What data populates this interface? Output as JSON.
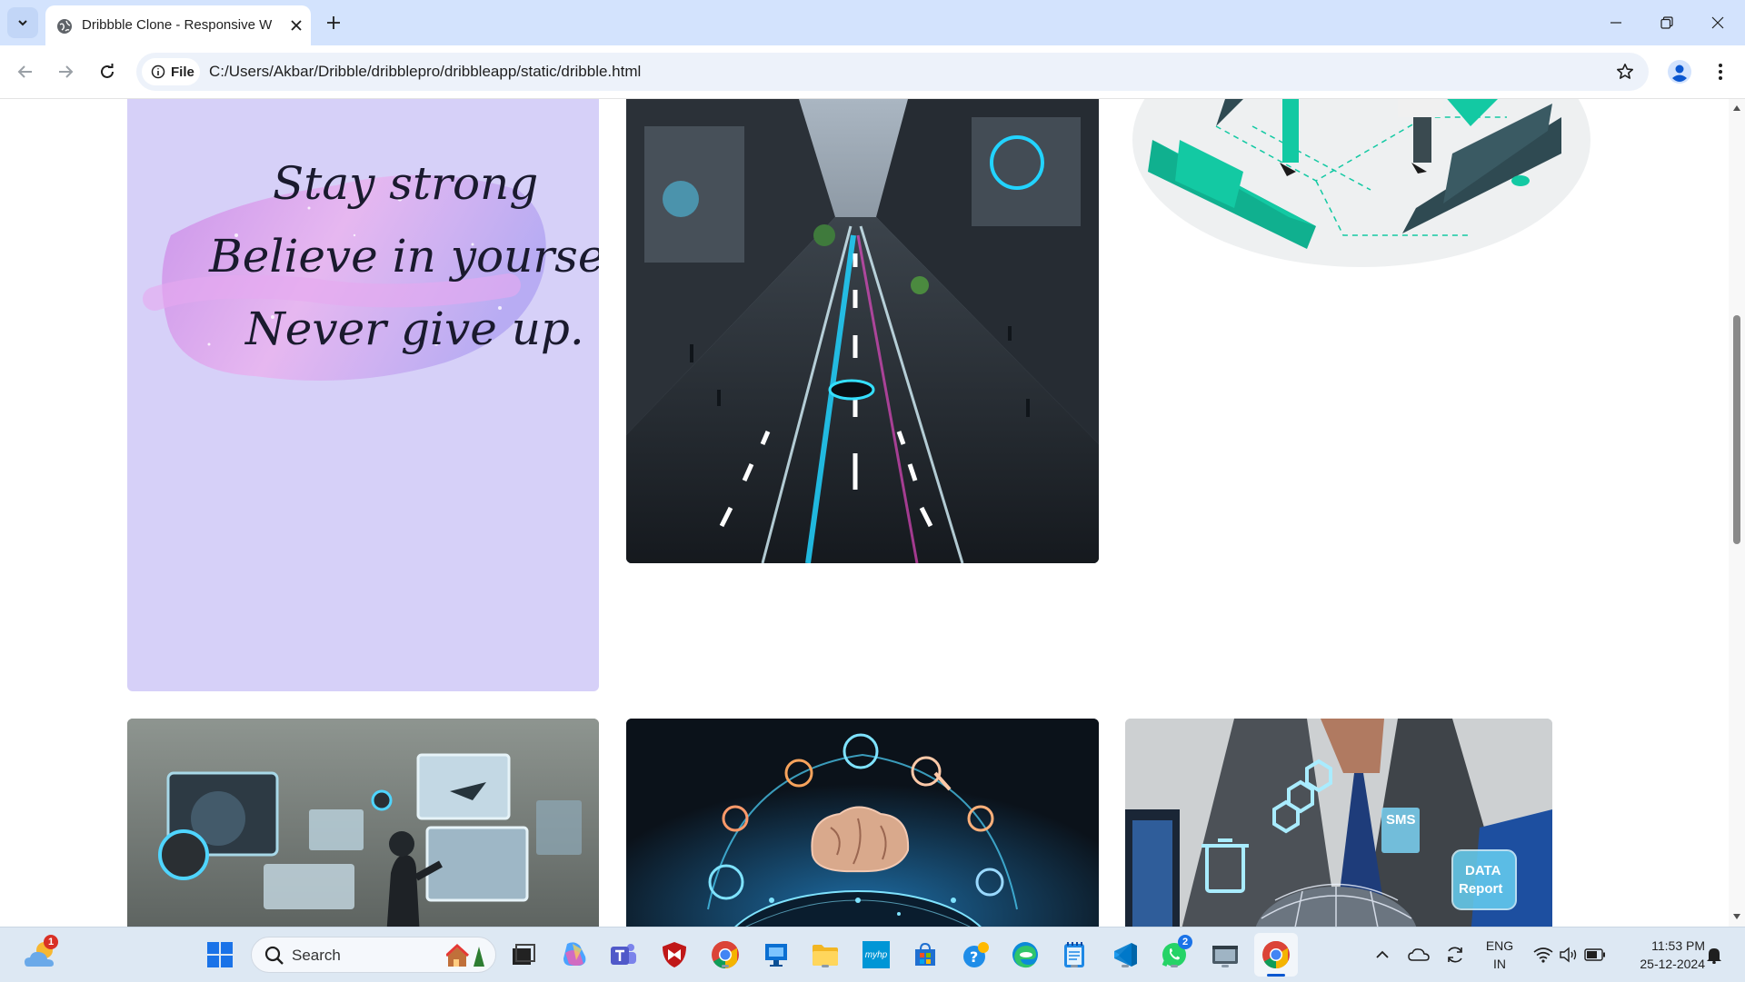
{
  "browser": {
    "tab_title": "Dribbble Clone - Responsive W",
    "url_chip": "File",
    "url": "C:/Users/Akbar/Dribble/dribblepro/dribbleapp/static/dribble.html"
  },
  "shots": {
    "quote_card": {
      "line1": "Stay strong",
      "line2": "Believe in yourself",
      "line3": "Never give up."
    },
    "data_card": {
      "label_sms": "SMS",
      "label_data": "DATA",
      "label_report": "Report"
    }
  },
  "taskbar": {
    "search_label": "Search",
    "weather_badge": "1",
    "whatsapp_badge": "2",
    "myhp_label": "myhp",
    "lang_line1": "ENG",
    "lang_line2": "IN",
    "time": "11:53 PM",
    "date": "25-12-2024"
  },
  "colors": {
    "tab_strip": "#d3e3fd",
    "quote_card_bg": "#d6d0f8",
    "laptop_teal": "#13c9a3",
    "laptop_dark": "#2f4a52"
  }
}
